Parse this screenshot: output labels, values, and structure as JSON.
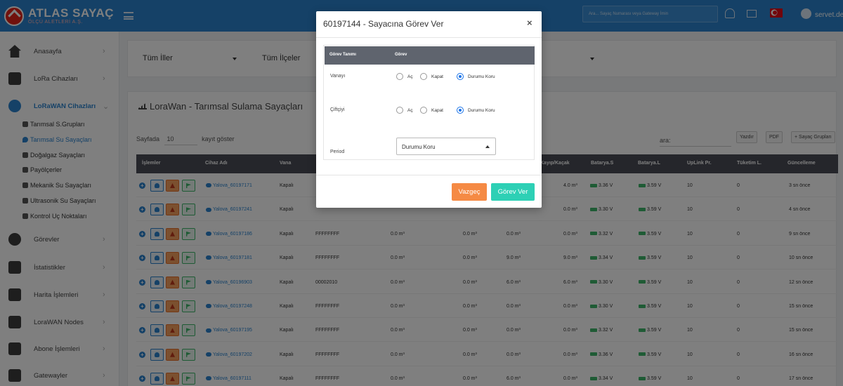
{
  "brand": {
    "title": "ATLAS SAYAÇ",
    "subtitle": "ÖLÇÜ ALETLERİ A.Ş."
  },
  "topbar": {
    "search_placeholder": "Ara... Sayaç Numarası veya Gateway İmin",
    "user_name": "servet.dev",
    "flag_color": "#e30a17",
    "accent": "#2a83cf"
  },
  "sidebar": {
    "items": [
      {
        "label": "Anasayfa",
        "icon": "home-icon"
      },
      {
        "label": "LoRa Cihazları",
        "icon": "car-icon"
      },
      {
        "label": "LoRaWAN Cihazları",
        "icon": "broadcast-icon",
        "active": true
      },
      {
        "label": "Görevler",
        "icon": "clock-icon"
      },
      {
        "label": "İstatistikler",
        "icon": "chart-icon"
      },
      {
        "label": "Harita İşlemleri",
        "icon": "map-icon"
      },
      {
        "label": "LoraWAN Nodes",
        "icon": "nodes-icon"
      },
      {
        "label": "Abone İşlemleri",
        "icon": "id-card-icon"
      },
      {
        "label": "Gatewayler",
        "icon": "antenna-icon"
      }
    ],
    "sub_items": [
      {
        "label": "Tarımsal S.Grupları"
      },
      {
        "label": "Tarımsal Su Sayaçları",
        "active": true
      },
      {
        "label": "Doğalgaz Sayaçları"
      },
      {
        "label": "Payölçerler"
      },
      {
        "label": "Mekanik Su Sayaçları"
      },
      {
        "label": "Ultrasonik Su Sayaçları"
      },
      {
        "label": "Kontrol Uç Noktaları"
      }
    ]
  },
  "filters": {
    "il": "Tüm İller",
    "ilce": "Tüm İlçeler"
  },
  "table_card": {
    "title": "LoraWan - Tarımsal Sulama Sayaçları",
    "length_prefix": "Sayfada",
    "length_value": "10",
    "length_suffix": "kayıt göster",
    "search_label": "ara:",
    "buttons": {
      "print": "Yazdır",
      "pdf": "PDF",
      "groups": "+ Sayaç Grupları"
    },
    "columns": [
      "İşlemler",
      "Cihaz Adı",
      "Vana",
      "Kayıp/Kaçak",
      "Batarya.S",
      "Batarya.L",
      "UpLink Pr.",
      "Tüketim L.",
      "Güncelleme"
    ],
    "rows": [
      {
        "name": "Yalova_60197171",
        "vana": "Kapalı",
        "id": "",
        "c1": "",
        "c2": "",
        "c3": "",
        "kayip": "4.0 m³",
        "bs": "3.36 V",
        "bl": "3.59 V",
        "up": "10",
        "tk": "0",
        "g": "3 sn önce"
      },
      {
        "name": "Yalova_60197241",
        "vana": "Kapalı",
        "id": "",
        "c1": "",
        "c2": "",
        "c3": "",
        "kayip": "0.0 m³",
        "bs": "3.30 V",
        "bl": "3.59 V",
        "up": "10",
        "tk": "0",
        "g": "4 sn önce"
      },
      {
        "name": "Yalova_60197186",
        "vana": "Kapalı",
        "id": "FFFFFFFF",
        "c1": "0.0 m³",
        "c2": "0.0 m³",
        "c3": "0.0 m³",
        "kayip": "0.0 m³",
        "bs": "3.32 V",
        "bl": "3.59 V",
        "up": "10",
        "tk": "0",
        "g": "9 sn önce"
      },
      {
        "name": "Yalova_60197181",
        "vana": "Kapalı",
        "id": "FFFFFFFF",
        "c1": "0.0 m³",
        "c2": "0.0 m³",
        "c3": "9.0 m³",
        "kayip": "9.0 m³",
        "bs": "3.34 V",
        "bl": "3.59 V",
        "up": "10",
        "tk": "0",
        "g": "10 sn önce"
      },
      {
        "name": "Yalova_60196903",
        "vana": "Kapalı",
        "id": "00002010",
        "c1": "0.0 m³",
        "c2": "0.0 m³",
        "c3": "6.0 m³",
        "kayip": "6.0 m³",
        "bs": "3.30 V",
        "bl": "3.59 V",
        "up": "10",
        "tk": "0",
        "g": "12 sn önce"
      },
      {
        "name": "Yalova_60197248",
        "vana": "Kapalı",
        "id": "FFFFFFFF",
        "c1": "0.0 m³",
        "c2": "0.0 m³",
        "c3": "0.0 m³",
        "kayip": "0.0 m³",
        "bs": "3.30 V",
        "bl": "3.59 V",
        "up": "10",
        "tk": "0",
        "g": "15 sn önce"
      },
      {
        "name": "Yalova_60197195",
        "vana": "Kapalı",
        "id": "FFFFFFFF",
        "c1": "0.0 m³",
        "c2": "0.0 m³",
        "c3": "0.0 m³",
        "kayip": "0.0 m³",
        "bs": "3.32 V",
        "bl": "3.59 V",
        "up": "10",
        "tk": "0",
        "g": "15 sn önce"
      },
      {
        "name": "Yalova_60197202",
        "vana": "Kapalı",
        "id": "FFFFFFFF",
        "c1": "0.0 m³",
        "c2": "0.0 m³",
        "c3": "0.0 m³",
        "kayip": "0.0 m³",
        "bs": "3.36 V",
        "bl": "3.59 V",
        "up": "10",
        "tk": "0",
        "g": "16 sn önce"
      },
      {
        "name": "Yalova_60197111",
        "vana": "Kapalı",
        "id": "FFFFFFFF",
        "c1": "0.0 m³",
        "c2": "0.0 m³",
        "c3": "6.0 m³",
        "kayip": "0.0 m³",
        "bs": "3.34 V",
        "bl": "3.59 V",
        "up": "10",
        "tk": "0",
        "g": "17 sn önce"
      }
    ]
  },
  "modal": {
    "title": "60197144 - Sayacına Görev Ver",
    "close_label": "×",
    "col_task_def": "Görev Tanımı",
    "col_task": "Görev",
    "rows": [
      {
        "label": "Vanayı",
        "options": [
          "Aç",
          "Kapat",
          "Durumu Koru"
        ],
        "selected": 2
      },
      {
        "label": "Çiftçiyi",
        "options": [
          "Aç",
          "Kapat",
          "Durumu Koru"
        ],
        "selected": 2
      }
    ],
    "period_label": "Period",
    "period_value": "Durumu Koru",
    "cancel_label": "Vazgeç",
    "submit_label": "Görev Ver",
    "cancel_color": "#f58a44",
    "submit_color": "#2dd0b5"
  }
}
